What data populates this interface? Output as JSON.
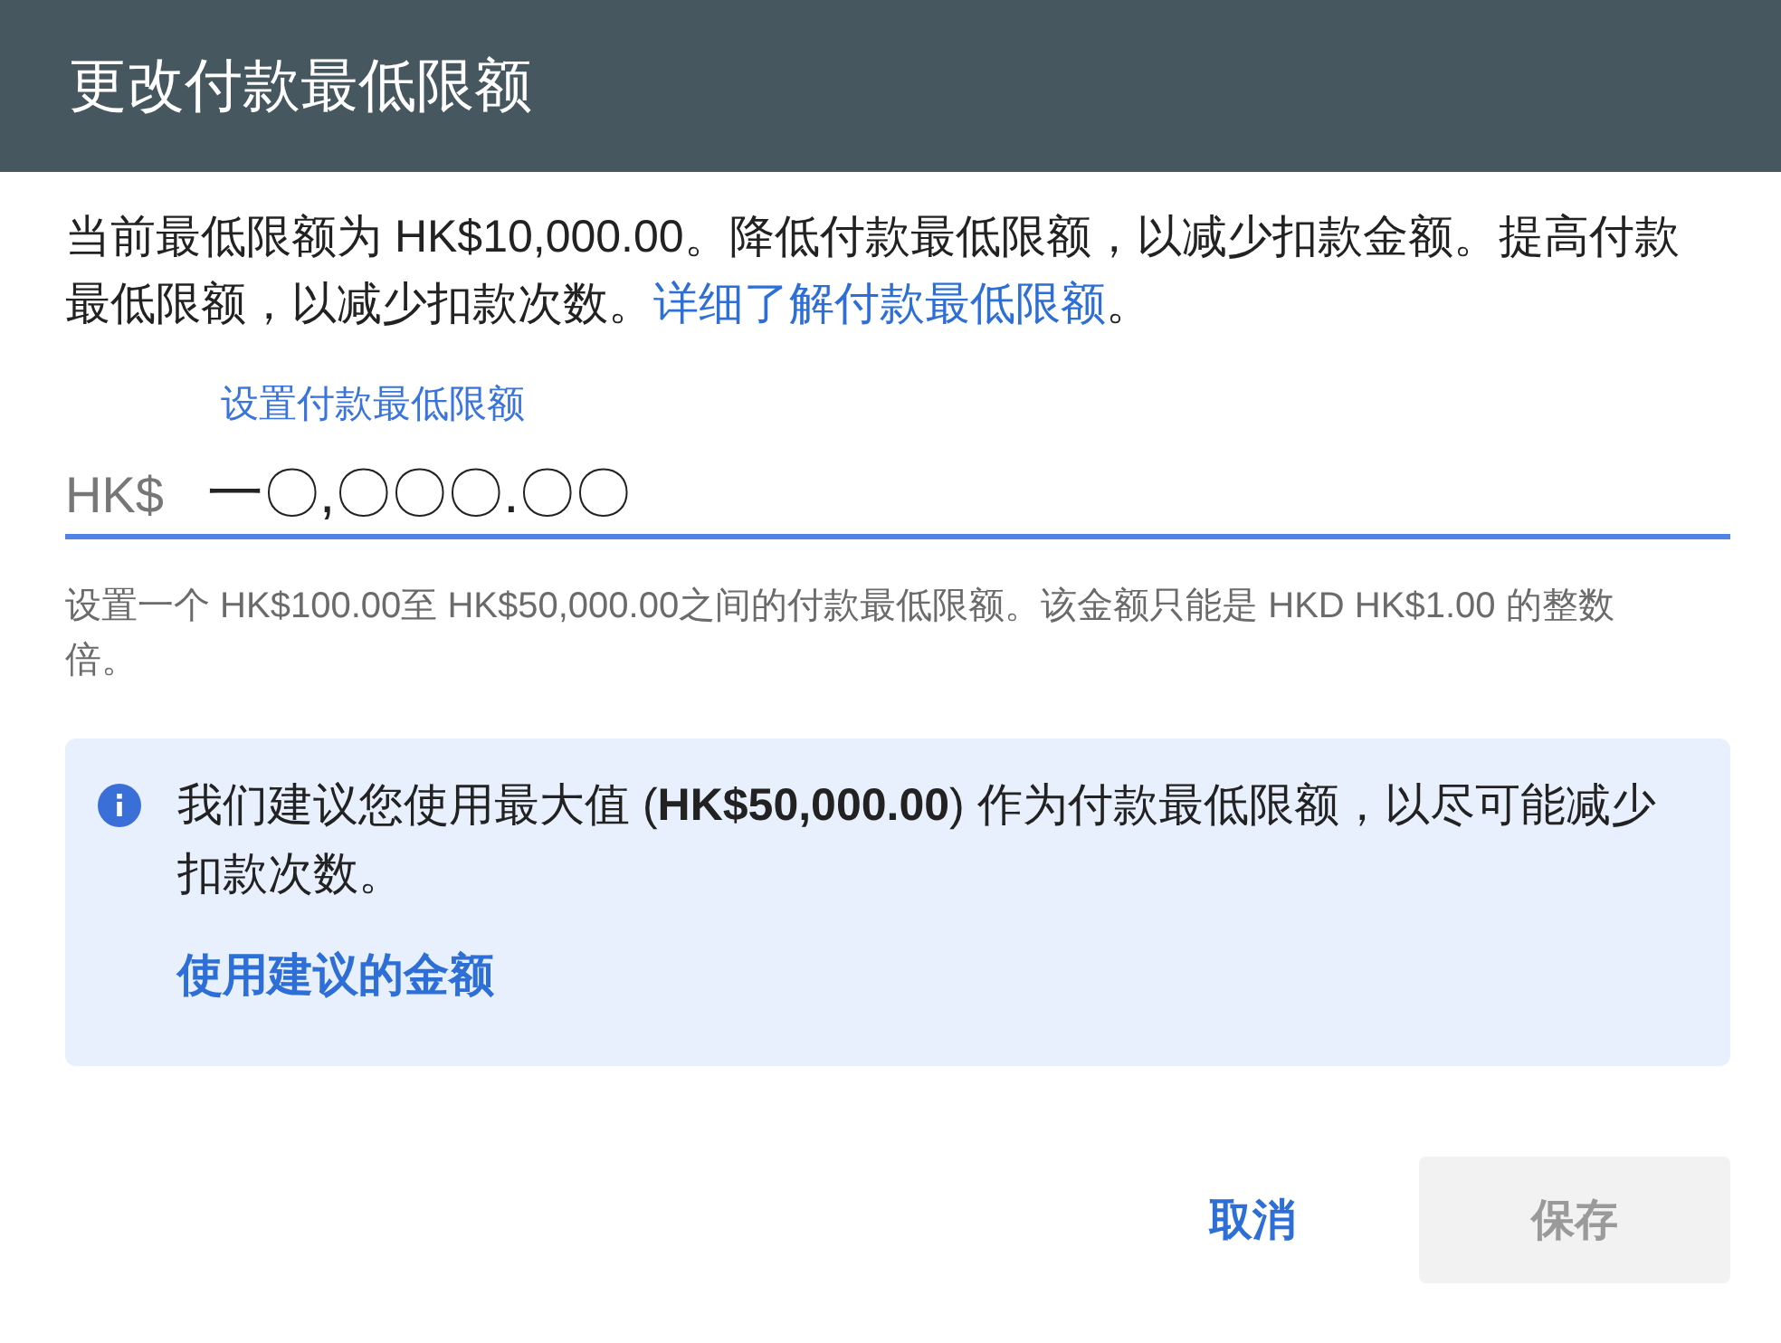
{
  "dialog": {
    "title": "更改付款最低限额",
    "intro": "当前最低限额为 HK$10,000.00。降低付款最低限额，以减少扣款金额。提高付款最低限额，以减少扣款次数。",
    "intro_link": "详细了解付款最低限额",
    "intro_end": "。",
    "field": {
      "label": "设置付款最低限额",
      "prefix": "HK$",
      "value": "一〇,〇〇〇.〇〇"
    },
    "helper": "设置一个 HK$100.00至 HK$50,000.00之间的付款最低限额。该金额只能是 HKD HK$1.00 的整数倍。",
    "notice": {
      "text": "我们建议您使用最大值 (**HK$50,000.00**) 作为付款最低限额，以尽可能减少扣款次数。",
      "action": "使用建议的金额"
    },
    "buttons": [
      {
        "label": "取消",
        "kind": "text",
        "disabled": false
      },
      {
        "label": "保存",
        "kind": "filled",
        "disabled": true
      }
    ]
  }
}
